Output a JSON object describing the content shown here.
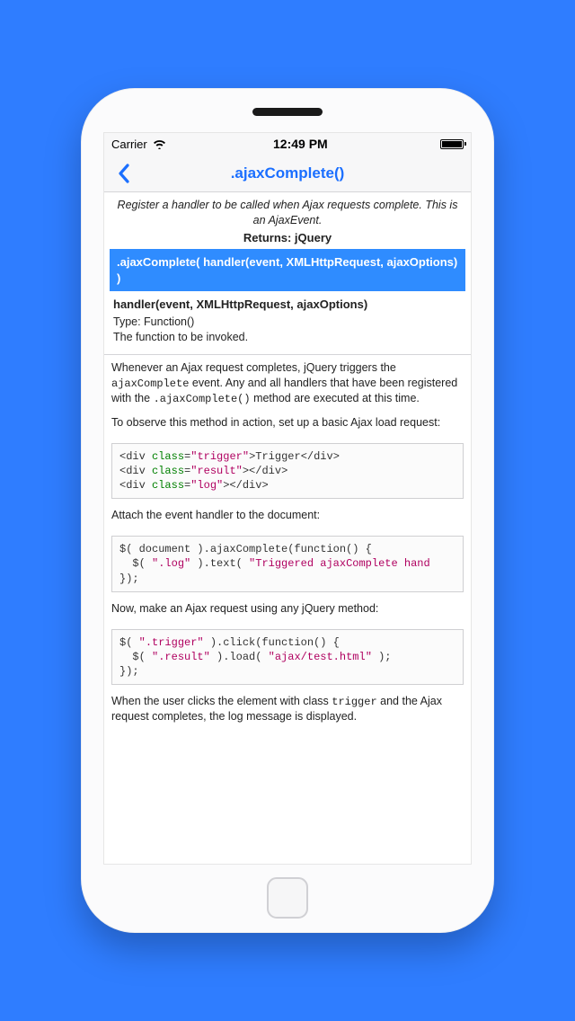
{
  "status": {
    "carrier": "Carrier",
    "time": "12:49 PM"
  },
  "nav": {
    "title": ".ajaxComplete()"
  },
  "doc": {
    "summary": "Register a handler to be called when Ajax requests complete. This is an AjaxEvent.",
    "returns": "Returns: jQuery",
    "signature": ".ajaxComplete( handler(event, XMLHttpRequest, ajaxOptions) )",
    "param_heading": "handler(event, XMLHttpRequest, ajaxOptions)",
    "param_type": "Type: Function()",
    "param_desc": "The function to be invoked.",
    "para1_a": "Whenever an Ajax request completes, jQuery triggers the ",
    "para1_code1": "ajaxComplete",
    "para1_b": " event. Any and all handlers that have been registered with the ",
    "para1_code2": ".ajaxComplete()",
    "para1_c": " method are executed at this time.",
    "para2": "To observe this method in action, set up a basic Ajax load request:",
    "para3": "Attach the event handler to the document:",
    "para4": "Now, make an Ajax request using any jQuery method:",
    "para5_a": "When the user clicks the element with class ",
    "para5_code": "trigger",
    "para5_b": " and the Ajax request completes, the log message is displayed.",
    "code1": {
      "c1": "trigger",
      "t1": "Trigger",
      "c2": "result",
      "c3": "log"
    },
    "code2": {
      "sel": ".log",
      "msg": "Triggered ajaxComplete hand"
    },
    "code3": {
      "sel1": ".trigger",
      "sel2": ".result",
      "url": "ajax/test.html"
    }
  }
}
